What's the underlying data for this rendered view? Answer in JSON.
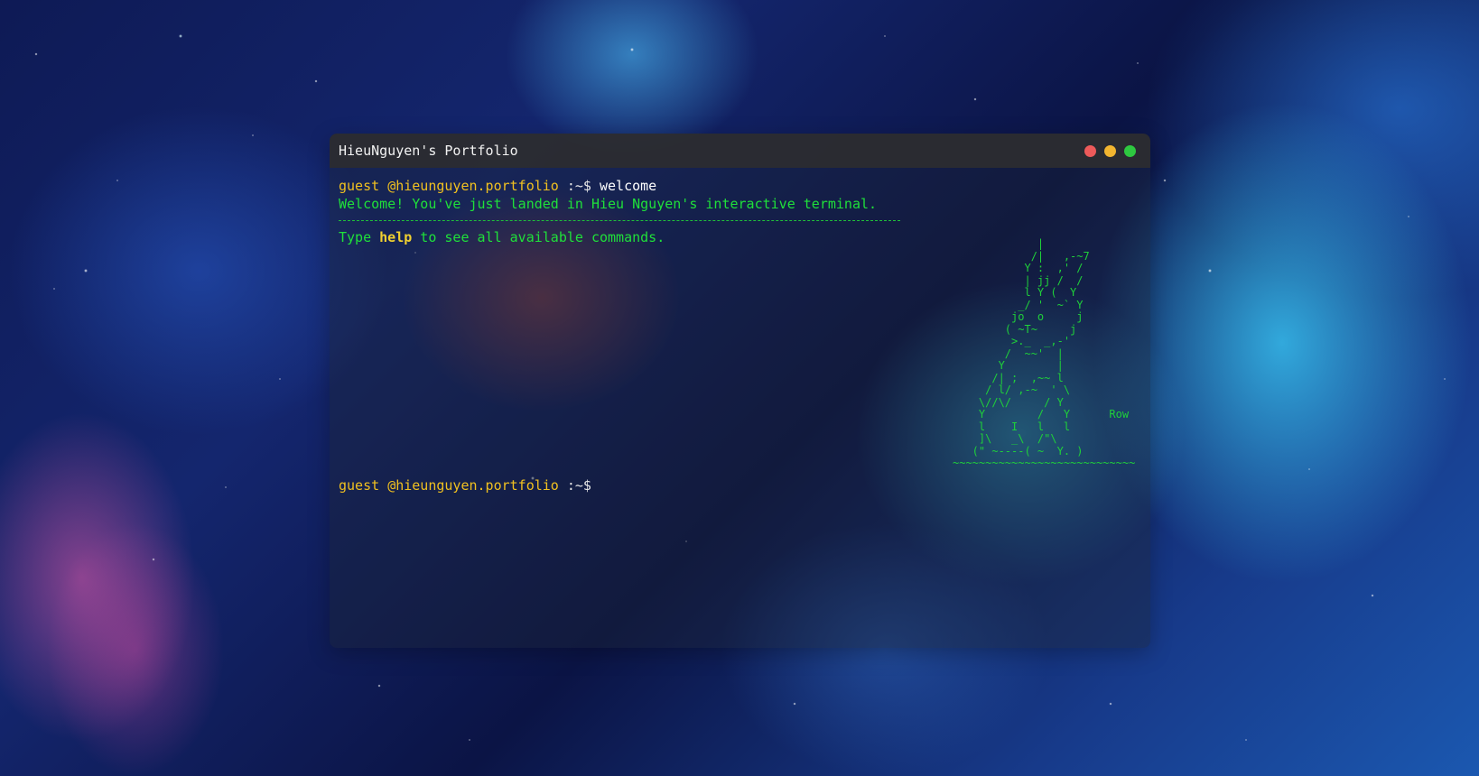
{
  "window": {
    "title": "HieuNguyen's Portfolio",
    "controls": {
      "close_color": "#ed5a5a",
      "minimize_color": "#f2b530",
      "maximize_color": "#2ec840"
    }
  },
  "prompt": {
    "user": "guest",
    "host": "@hieunguyen.portfolio",
    "path": " :~$"
  },
  "history": [
    {
      "command": "welcome",
      "output_welcome": "Welcome! You've just landed in Hieu Nguyen's interactive terminal.",
      "help_prefix": "Type ",
      "help_keyword": "help",
      "help_suffix": " to see all available commands."
    }
  ],
  "ascii_art": "             |\n            /|   ,-~7\n           Y :  ,' /\n           | jj /  /\n           l Y (  Y\n          _/ '  ~` Y\n         jo  o     j\n        ( ~T~     j\n         >._  _,-'\n        /  ~~'  |\n       Y        |\n      /| ;  ,~~ l\n     / l/ ,-~  ' \\\n    \\//\\/     / Y\n    Y        /   Y      Row\n    l    I   l   l\n    ]\\   _\\  /\"\\\n   (\" ~----( ~  Y. )\n~~~~~~~~~~~~~~~~~~~~~~~~~~~~",
  "current_input": ""
}
